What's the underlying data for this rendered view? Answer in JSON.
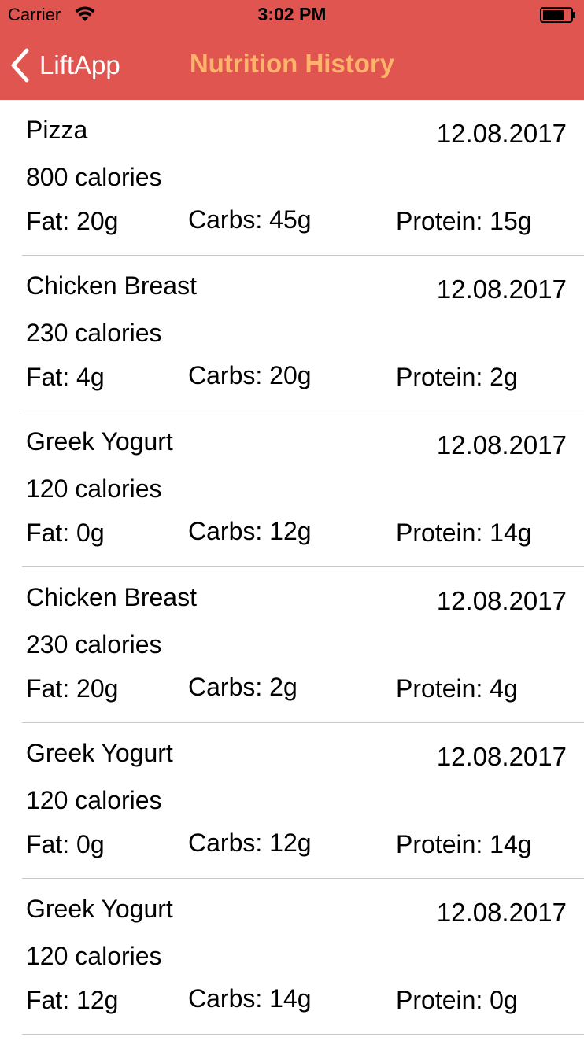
{
  "status_bar": {
    "carrier": "Carrier",
    "time": "3:02 PM"
  },
  "nav": {
    "back_label": "LiftApp",
    "title": "Nutrition History",
    "bar_color": "#e0554f",
    "title_color": "#ffb36b"
  },
  "entries": [
    {
      "name": "Pizza",
      "date": "12.08.2017",
      "calories": "800 calories",
      "fat": "Fat: 20g",
      "carbs": "Carbs: 45g",
      "protein": "Protein: 15g"
    },
    {
      "name": "Chicken Breast",
      "date": "12.08.2017",
      "calories": "230 calories",
      "fat": "Fat: 4g",
      "carbs": "Carbs: 20g",
      "protein": "Protein: 2g"
    },
    {
      "name": "Greek Yogurt",
      "date": "12.08.2017",
      "calories": "120 calories",
      "fat": "Fat: 0g",
      "carbs": "Carbs: 12g",
      "protein": "Protein: 14g"
    },
    {
      "name": "Chicken Breast",
      "date": "12.08.2017",
      "calories": "230 calories",
      "fat": "Fat: 20g",
      "carbs": "Carbs: 2g",
      "protein": "Protein: 4g"
    },
    {
      "name": "Greek Yogurt",
      "date": "12.08.2017",
      "calories": "120 calories",
      "fat": "Fat: 0g",
      "carbs": "Carbs: 12g",
      "protein": "Protein: 14g"
    },
    {
      "name": "Greek Yogurt",
      "date": "12.08.2017",
      "calories": "120 calories",
      "fat": "Fat: 12g",
      "carbs": "Carbs: 14g",
      "protein": "Protein: 0g"
    }
  ]
}
